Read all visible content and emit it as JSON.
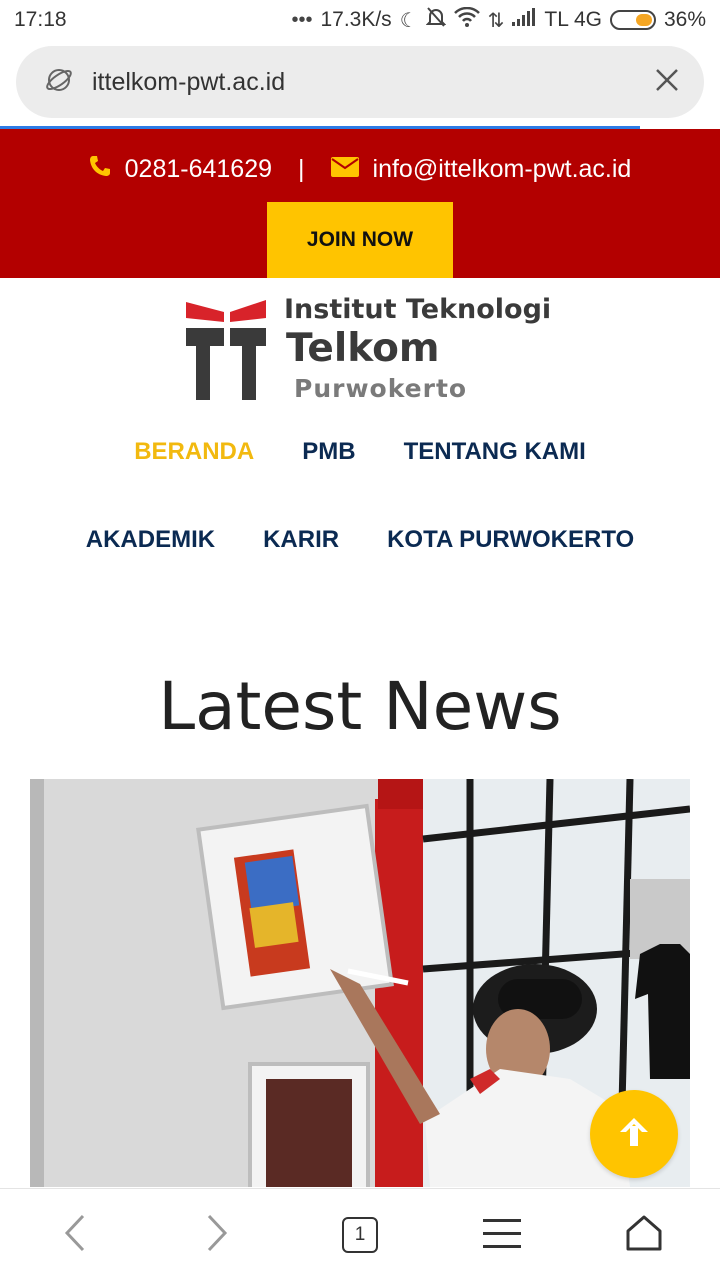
{
  "status_bar": {
    "time": "17:18",
    "net_speed": "17.3K/s",
    "carrier": "TL 4G",
    "battery": "36%"
  },
  "browser": {
    "url": "ittelkom-pwt.ac.id",
    "tab_count": "1"
  },
  "topbar": {
    "phone": "0281-641629",
    "separator": "|",
    "email": "info@ittelkom-pwt.ac.id",
    "join_label": "JOIN NOW",
    "bg_color": "#b30000",
    "accent_color": "#ffc400"
  },
  "logo": {
    "line1": "Institut Teknologi",
    "line2": "Telkom",
    "line3": "Purwokerto"
  },
  "nav": {
    "row1": [
      "BERANDA",
      "PMB",
      "TENTANG KAMI"
    ],
    "row2": [
      "AKADEMIK",
      "KARIR",
      "KOTA PURWOKERTO"
    ],
    "active": "BERANDA"
  },
  "main": {
    "section_title": "Latest News"
  },
  "icons": {
    "globe": "globe-icon",
    "close": "close-icon",
    "phone": "phone-icon",
    "mail": "mail-icon",
    "back": "back-icon",
    "forward": "forward-icon",
    "tabs": "tabs-icon",
    "menu": "menu-icon",
    "home": "home-icon",
    "scroll_top": "arrow-up-icon"
  }
}
